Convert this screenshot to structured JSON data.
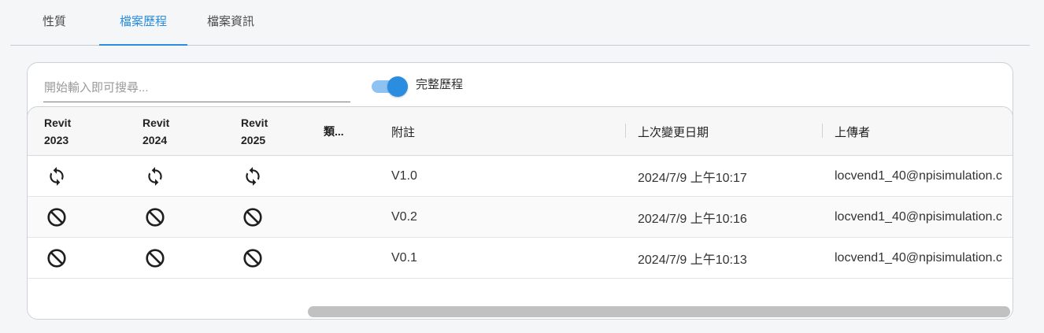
{
  "tabs": [
    {
      "label": "性質"
    },
    {
      "label": "檔案歷程"
    },
    {
      "label": "檔案資訊"
    }
  ],
  "search": {
    "placeholder": "開始輸入即可搜尋..."
  },
  "toggle": {
    "label": "完整歷程",
    "on": true
  },
  "table": {
    "headers": {
      "revit2023": [
        "Revit",
        "2023"
      ],
      "revit2024": [
        "Revit",
        "2024"
      ],
      "revit2025": [
        "Revit",
        "2025"
      ],
      "type": "類...",
      "note": "附註",
      "modified": "上次變更日期",
      "uploader": "上傳者"
    },
    "rows": [
      {
        "icons": [
          "sync-icon",
          "sync-icon",
          "sync-icon"
        ],
        "note": "V1.0",
        "modified": "2024/7/9 上午10:17",
        "uploader": "locvend1_40@npisimulation.c"
      },
      {
        "icons": [
          "block-icon",
          "block-icon",
          "block-icon"
        ],
        "note": "V0.2",
        "modified": "2024/7/9 上午10:16",
        "uploader": "locvend1_40@npisimulation.c"
      },
      {
        "icons": [
          "block-icon",
          "block-icon",
          "block-icon"
        ],
        "note": "V0.1",
        "modified": "2024/7/9 上午10:13",
        "uploader": "locvend1_40@npisimulation.c"
      }
    ]
  },
  "colors": {
    "accent": "#2a8de0",
    "toggle_track": "#8ec2f2"
  }
}
